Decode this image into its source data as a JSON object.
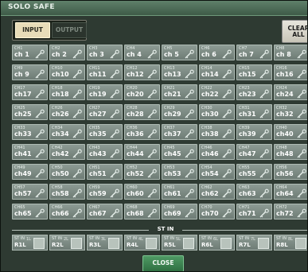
{
  "window": {
    "title": "SOLO SAFE"
  },
  "tabs": [
    {
      "label": "INPUT",
      "active": true
    },
    {
      "label": "OUTPUT",
      "active": false
    }
  ],
  "clear_all": [
    "CLEAR",
    "ALL"
  ],
  "channels": [
    [
      {
        "id": "CH1",
        "name": "ch 1"
      },
      {
        "id": "CH2",
        "name": "ch 2"
      },
      {
        "id": "CH3",
        "name": "ch 3"
      },
      {
        "id": "CH4",
        "name": "ch 4"
      },
      {
        "id": "CH5",
        "name": "ch 5"
      },
      {
        "id": "CH6",
        "name": "ch 6"
      },
      {
        "id": "CH7",
        "name": "ch 7"
      },
      {
        "id": "CH8",
        "name": "ch 8"
      }
    ],
    [
      {
        "id": "CH9",
        "name": "ch 9"
      },
      {
        "id": "CH10",
        "name": "ch10"
      },
      {
        "id": "CH11",
        "name": "ch11"
      },
      {
        "id": "CH12",
        "name": "ch12"
      },
      {
        "id": "CH13",
        "name": "ch13"
      },
      {
        "id": "CH14",
        "name": "ch14"
      },
      {
        "id": "CH15",
        "name": "ch15"
      },
      {
        "id": "CH16",
        "name": "ch16"
      }
    ],
    [
      {
        "id": "CH17",
        "name": "ch17"
      },
      {
        "id": "CH18",
        "name": "ch18"
      },
      {
        "id": "CH19",
        "name": "ch19"
      },
      {
        "id": "CH20",
        "name": "ch20"
      },
      {
        "id": "CH21",
        "name": "ch21"
      },
      {
        "id": "CH22",
        "name": "ch22"
      },
      {
        "id": "CH23",
        "name": "ch23"
      },
      {
        "id": "CH24",
        "name": "ch24"
      }
    ],
    [
      {
        "id": "CH25",
        "name": "ch25"
      },
      {
        "id": "CH26",
        "name": "ch26"
      },
      {
        "id": "CH27",
        "name": "ch27"
      },
      {
        "id": "CH28",
        "name": "ch28"
      },
      {
        "id": "CH29",
        "name": "ch29"
      },
      {
        "id": "CH30",
        "name": "ch30"
      },
      {
        "id": "CH31",
        "name": "ch31"
      },
      {
        "id": "CH32",
        "name": "ch32"
      }
    ],
    [
      {
        "id": "CH33",
        "name": "ch33"
      },
      {
        "id": "CH34",
        "name": "ch34"
      },
      {
        "id": "CH35",
        "name": "ch35"
      },
      {
        "id": "CH36",
        "name": "ch36"
      },
      {
        "id": "CH37",
        "name": "ch37"
      },
      {
        "id": "CH38",
        "name": "ch38"
      },
      {
        "id": "CH39",
        "name": "ch39"
      },
      {
        "id": "CH40",
        "name": "ch40"
      }
    ],
    [
      {
        "id": "CH41",
        "name": "ch41"
      },
      {
        "id": "CH42",
        "name": "ch42"
      },
      {
        "id": "CH43",
        "name": "ch43"
      },
      {
        "id": "CH44",
        "name": "ch44"
      },
      {
        "id": "CH45",
        "name": "ch45"
      },
      {
        "id": "CH46",
        "name": "ch46"
      },
      {
        "id": "CH47",
        "name": "ch47"
      },
      {
        "id": "CH48",
        "name": "ch48"
      }
    ],
    [
      {
        "id": "CH49",
        "name": "ch49"
      },
      {
        "id": "CH50",
        "name": "ch50"
      },
      {
        "id": "CH51",
        "name": "ch51"
      },
      {
        "id": "CH52",
        "name": "ch52"
      },
      {
        "id": "CH53",
        "name": "ch53"
      },
      {
        "id": "CH54",
        "name": "ch54"
      },
      {
        "id": "CH55",
        "name": "ch55"
      },
      {
        "id": "CH56",
        "name": "ch56"
      }
    ],
    [
      {
        "id": "CH57",
        "name": "ch57"
      },
      {
        "id": "CH58",
        "name": "ch58"
      },
      {
        "id": "CH59",
        "name": "ch59"
      },
      {
        "id": "CH60",
        "name": "ch60"
      },
      {
        "id": "CH61",
        "name": "ch61"
      },
      {
        "id": "CH62",
        "name": "ch62"
      },
      {
        "id": "CH63",
        "name": "ch63"
      },
      {
        "id": "CH64",
        "name": "ch64"
      }
    ],
    [
      {
        "id": "CH65",
        "name": "ch65"
      },
      {
        "id": "CH66",
        "name": "ch66"
      },
      {
        "id": "CH67",
        "name": "ch67"
      },
      {
        "id": "CH68",
        "name": "ch68"
      },
      {
        "id": "CH69",
        "name": "ch69"
      },
      {
        "id": "CH70",
        "name": "ch70"
      },
      {
        "id": "CH71",
        "name": "ch71"
      },
      {
        "id": "CH72",
        "name": "ch72"
      }
    ]
  ],
  "st_in": {
    "label": "ST IN",
    "items": [
      {
        "top": "ST IN",
        "sub": "1L",
        "name": "R1L"
      },
      {
        "top": "ST IN",
        "sub": "2L",
        "name": "R2L"
      },
      {
        "top": "ST IN",
        "sub": "3L",
        "name": "R3L"
      },
      {
        "top": "ST IN",
        "sub": "4L",
        "name": "R4L"
      },
      {
        "top": "ST IN",
        "sub": "5L",
        "name": "R5L"
      },
      {
        "top": "ST IN",
        "sub": "6L",
        "name": "R6L"
      },
      {
        "top": "ST IN",
        "sub": "7L",
        "name": "R7L"
      },
      {
        "top": "ST IN",
        "sub": "8L",
        "name": "R8L"
      }
    ]
  },
  "close_label": "CLOSE",
  "colors": {
    "title_bar": "#4d6d57",
    "cell": "#7f8d86",
    "active_tab": "#e8dcb8",
    "close_button": "#3f8554"
  }
}
